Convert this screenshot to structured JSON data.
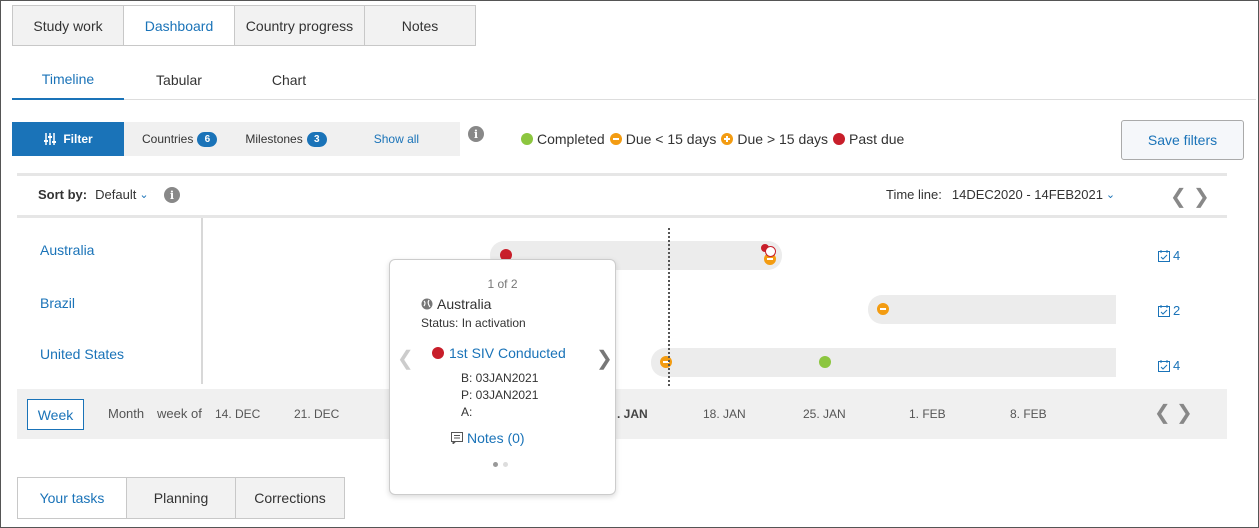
{
  "top_tabs": [
    "Study work",
    "Dashboard",
    "Country progress",
    "Notes"
  ],
  "top_tab_active": "Dashboard",
  "sub_tabs": [
    "Timeline",
    "Tabular",
    "Chart"
  ],
  "sub_tab_active": "Timeline",
  "filter": {
    "filter_label": "Filter",
    "countries_label": "Countries",
    "countries_count": "6",
    "milestones_label": "Milestones",
    "milestones_count": "3",
    "show_all": "Show all"
  },
  "legend": {
    "completed": "Completed",
    "due_lt_15": "Due < 15 days",
    "due_gt_15": "Due > 15 days",
    "past_due": "Past due",
    "colors": {
      "completed": "#8cc63f",
      "due": "#f39c12",
      "past_due": "#c81e2a"
    }
  },
  "save_filters": "Save filters",
  "sort": {
    "label": "Sort by:",
    "value": "Default"
  },
  "timeline": {
    "label": "Time line:",
    "range": "14DEC2020 - 14FEB2021"
  },
  "countries": [
    {
      "name": "Australia",
      "count": "4"
    },
    {
      "name": "Brazil",
      "count": "2"
    },
    {
      "name": "United States",
      "count": "4"
    }
  ],
  "scale": {
    "week": "Week",
    "month": "Month",
    "week_of": "week of",
    "ticks": [
      "14. DEC",
      "21. DEC",
      ". JAN",
      "18. JAN",
      "25. JAN",
      "1. FEB",
      "8. FEB"
    ]
  },
  "popup": {
    "page": "1 of 2",
    "country": "Australia",
    "status": "Status: In activation",
    "milestone": "1st SIV Conducted",
    "b": "B: 03JAN2021",
    "p": "P: 03JAN2021",
    "a": "A:",
    "notes": "Notes (0)"
  },
  "bottom_tabs": [
    "Your tasks",
    "Planning",
    "Corrections"
  ],
  "bottom_tab_active": "Your tasks",
  "accent": "#1a73b8"
}
